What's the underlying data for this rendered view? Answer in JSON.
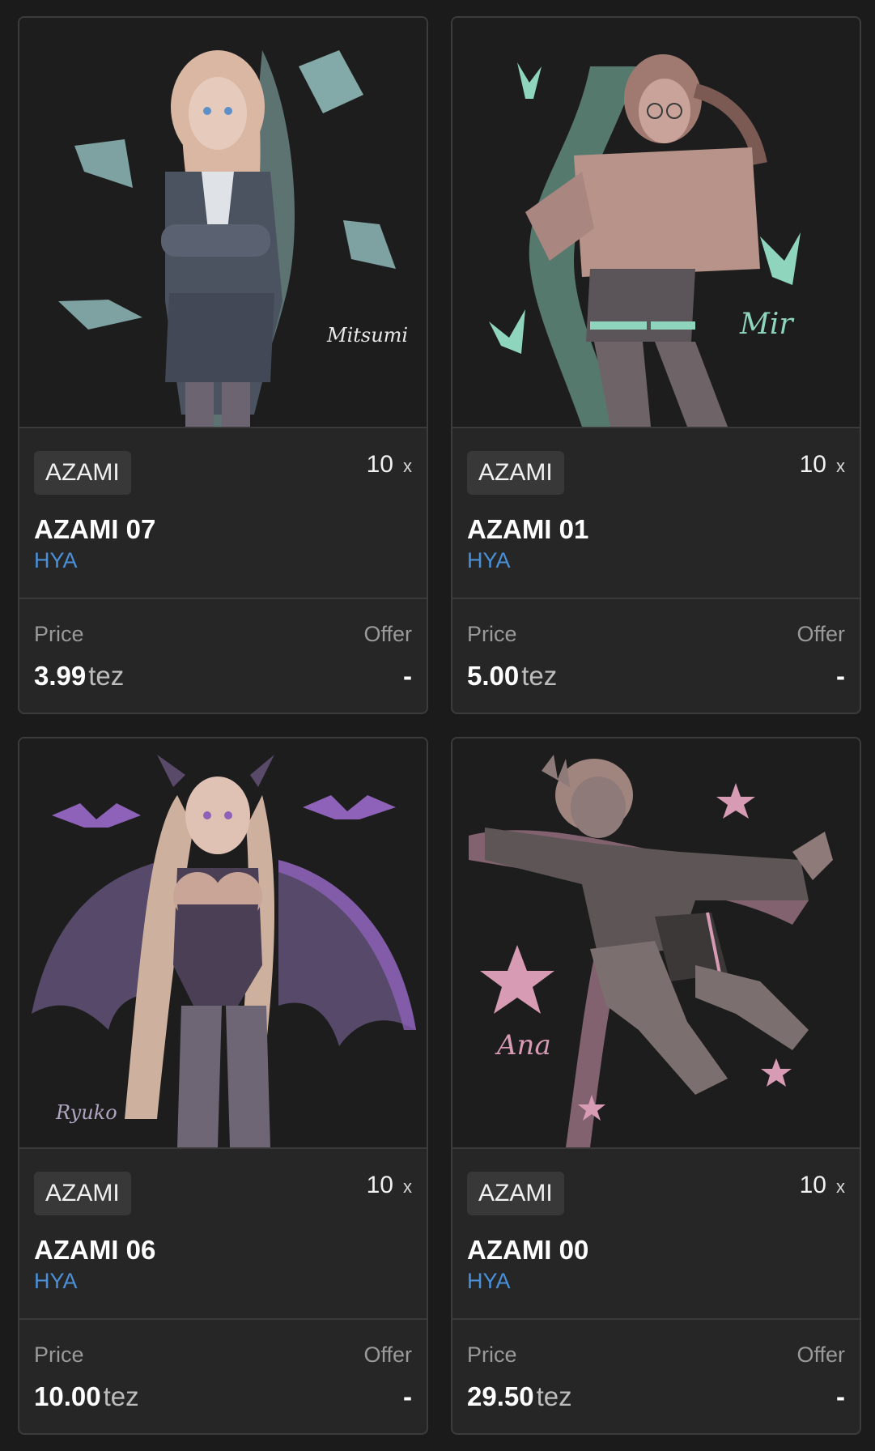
{
  "cards": [
    {
      "collection": "AZAMI",
      "editions": "10",
      "editions_mark": "x",
      "title": "AZAMI 07",
      "artist": "HYA",
      "price_label": "Price",
      "offer_label": "Offer",
      "price_value": "3.99",
      "price_unit": "tez",
      "offer_value": "-",
      "accent": "#8fb9b8",
      "skin": "#d7b8a6",
      "outfit": "#4b5260",
      "signature": "Mitsumi"
    },
    {
      "collection": "AZAMI",
      "editions": "10",
      "editions_mark": "x",
      "title": "AZAMI 01",
      "artist": "HYA",
      "price_label": "Price",
      "offer_label": "Offer",
      "price_value": "5.00",
      "price_unit": "tez",
      "offer_value": "-",
      "accent": "#8fd5bd",
      "skin": "#b89389",
      "outfit": "#7c6f75",
      "signature": "Mir"
    },
    {
      "collection": "AZAMI",
      "editions": "10",
      "editions_mark": "x",
      "title": "AZAMI 06",
      "artist": "HYA",
      "price_label": "Price",
      "offer_label": "Offer",
      "price_value": "10.00",
      "price_unit": "tez",
      "offer_value": "-",
      "accent": "#8d62b8",
      "skin": "#c9a597",
      "outfit": "#4a3f55",
      "signature": "Ryuko"
    },
    {
      "collection": "AZAMI",
      "editions": "10",
      "editions_mark": "x",
      "title": "AZAMI 00",
      "artist": "HYA",
      "price_label": "Price",
      "offer_label": "Offer",
      "price_value": "29.50",
      "price_unit": "tez",
      "offer_value": "-",
      "accent": "#d79bb4",
      "skin": "#8e7a78",
      "outfit": "#5e5656",
      "signature": "Ana"
    }
  ]
}
